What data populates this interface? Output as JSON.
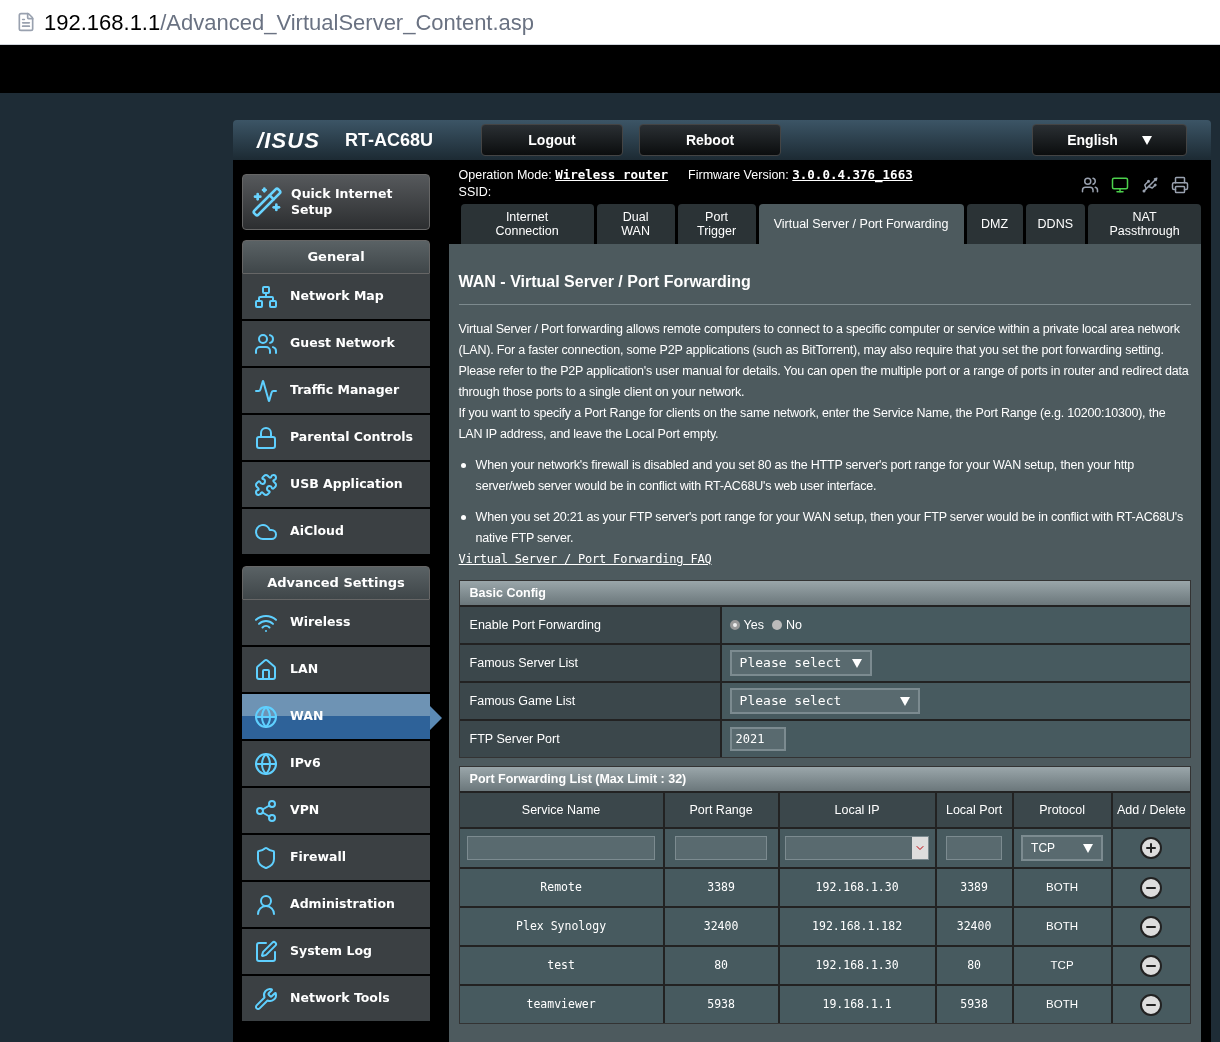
{
  "address_bar": {
    "host": "192.168.1.1",
    "path": "/Advanced_VirtualServer_Content.asp"
  },
  "header": {
    "logo": "/ISUS",
    "model": "RT-AC68U",
    "buttons": [
      "Logout",
      "Reboot"
    ],
    "language": "English"
  },
  "status": {
    "mode_label": "Operation Mode:",
    "mode": "Wireless router",
    "firmware_label": "Firmware Version:",
    "firmware": "3.0.0.4.376_1663",
    "ssid_label": "SSID:",
    "icons": [
      {
        "kind": "clients",
        "active": false
      },
      {
        "kind": "network",
        "active": true
      },
      {
        "kind": "usb",
        "active": false
      },
      {
        "kind": "printer",
        "active": false
      }
    ]
  },
  "quick_setup": "Quick Internet Setup",
  "sidebar": [
    {
      "title": "General",
      "items": [
        {
          "label": "Network Map",
          "selected": false
        },
        {
          "label": "Guest Network",
          "selected": false
        },
        {
          "label": "Traffic Manager",
          "selected": false
        },
        {
          "label": "Parental Controls",
          "selected": false
        },
        {
          "label": "USB Application",
          "selected": false
        },
        {
          "label": "AiCloud",
          "selected": false
        }
      ]
    },
    {
      "title": "Advanced Settings",
      "items": [
        {
          "label": "Wireless",
          "selected": false
        },
        {
          "label": "LAN",
          "selected": false
        },
        {
          "label": "WAN",
          "selected": true
        },
        {
          "label": "IPv6",
          "selected": false
        },
        {
          "label": "VPN",
          "selected": false
        },
        {
          "label": "Firewall",
          "selected": false
        },
        {
          "label": "Administration",
          "selected": false
        },
        {
          "label": "System Log",
          "selected": false
        },
        {
          "label": "Network Tools",
          "selected": false
        }
      ]
    }
  ],
  "tabs": [
    {
      "label": "Internet Connection",
      "selected": false
    },
    {
      "label": "Dual WAN",
      "selected": false
    },
    {
      "label": "Port Trigger",
      "selected": false
    },
    {
      "label": "Virtual Server / Port Forwarding",
      "selected": true
    },
    {
      "label": "DMZ",
      "selected": false
    },
    {
      "label": "DDNS",
      "selected": false
    },
    {
      "label": "NAT Passthrough",
      "selected": false
    }
  ],
  "page_title": "WAN - Virtual Server / Port Forwarding",
  "description": [
    "Virtual Server / Port forwarding allows remote computers to connect to a specific computer or service within a private local area network (LAN). For a faster connection, some P2P applications (such as BitTorrent), may also require that you set the port forwarding setting. Please refer to the P2P application's user manual for details. You can open the multiple port or a range of ports in router and redirect data through those ports to a single client on your network.",
    "If you want to specify a Port Range for clients on the same network, enter the Service Name, the Port Range (e.g. 10200:10300), the LAN IP address, and leave the Local Port empty."
  ],
  "notes": [
    "When your network's firewall is disabled and you set 80 as the HTTP server's port range for your WAN setup, then your http server/web server would be in conflict with RT-AC68U's web user interface.",
    "When you set 20:21 as your FTP server's port range for your WAN setup, then your FTP server would be in conflict with RT-AC68U's native FTP server."
  ],
  "faq_link": "Virtual Server / Port Forwarding FAQ",
  "basic_config": {
    "title": "Basic Config",
    "rows": [
      {
        "kind": "radio",
        "label": "Enable Port Forwarding",
        "options": [
          {
            "label": "Yes",
            "selected": true
          },
          {
            "label": "No",
            "selected": false
          }
        ]
      },
      {
        "kind": "select",
        "label": "Famous Server List",
        "value": "Please select",
        "wide": false
      },
      {
        "kind": "select",
        "label": "Famous Game List",
        "value": "Please select",
        "wide": true
      },
      {
        "kind": "input",
        "label": "FTP Server Port",
        "value": "2021"
      }
    ]
  },
  "port_list": {
    "title": "Port Forwarding List (Max Limit : 32)",
    "columns": [
      "Service Name",
      "Port Range",
      "Local IP",
      "Local Port",
      "Protocol",
      "Add / Delete"
    ],
    "new_protocol": "TCP",
    "rows": [
      {
        "service": "Remote",
        "port_range": "3389",
        "local_ip": "192.168.1.30",
        "local_port": "3389",
        "protocol": "BOTH"
      },
      {
        "service": "Plex Synology",
        "port_range": "32400",
        "local_ip": "192.168.1.182",
        "local_port": "32400",
        "protocol": "BOTH"
      },
      {
        "service": "test",
        "port_range": "80",
        "local_ip": "192.168.1.30",
        "local_port": "80",
        "protocol": "TCP"
      },
      {
        "service": "teamviewer",
        "port_range": "5938",
        "local_ip": "19.168.1.1",
        "local_port": "5938",
        "protocol": "BOTH"
      }
    ]
  }
}
